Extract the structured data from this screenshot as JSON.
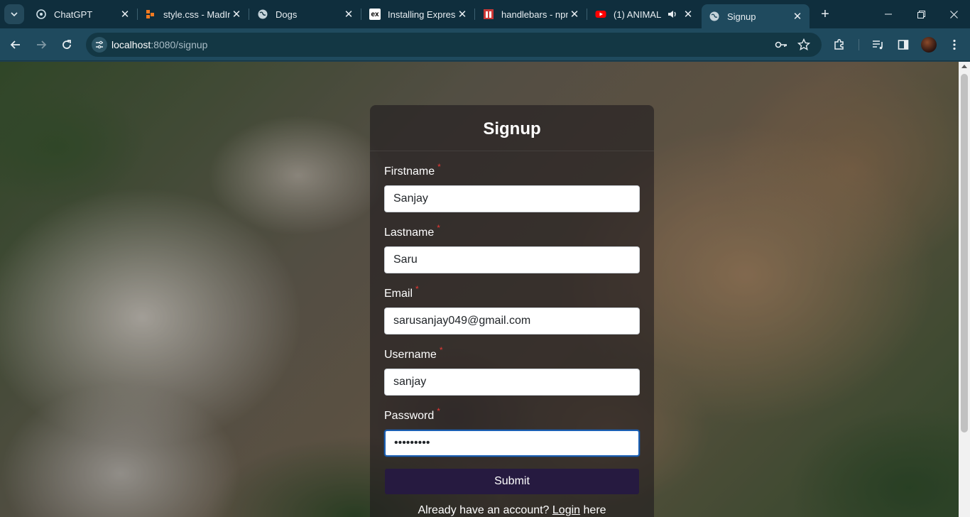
{
  "browser": {
    "tabs": [
      {
        "title": "ChatGPT",
        "icon": "chatgpt-icon"
      },
      {
        "title": "style.css - MadIn",
        "icon": "madlab-icon"
      },
      {
        "title": "Dogs",
        "icon": "globe-icon"
      },
      {
        "title": "Installing Express",
        "icon": "express-icon"
      },
      {
        "title": "handlebars - npm",
        "icon": "npm-icon"
      },
      {
        "title": "(1) ANIMAL",
        "icon": "youtube-icon"
      },
      {
        "title": "Signup",
        "icon": "globe-icon",
        "active": true
      }
    ],
    "address": {
      "host": "localhost",
      "path": ":8080/signup"
    },
    "tab_close_glyph": "✕",
    "new_tab_glyph": "+",
    "window_controls": {
      "minimize": "—",
      "restore": "❐",
      "close": "✕"
    }
  },
  "form": {
    "title": "Signup",
    "required_mark": "*",
    "fields": [
      {
        "label": "Firstname",
        "value": "Sanjay"
      },
      {
        "label": "Lastname",
        "value": "Saru"
      },
      {
        "label": "Email",
        "value": "sarusanjay049@gmail.com"
      },
      {
        "label": "Username",
        "value": "sanjay"
      },
      {
        "label": "Password",
        "value": "•••••••••"
      }
    ],
    "submit_label": "Submit",
    "login_prompt": "Already have an account?",
    "login_link": "Login",
    "login_suffix": "here"
  },
  "colors": {
    "submit_bg": "#261a40",
    "required": "#e53935",
    "browser_chrome": "#1f4a5e"
  }
}
